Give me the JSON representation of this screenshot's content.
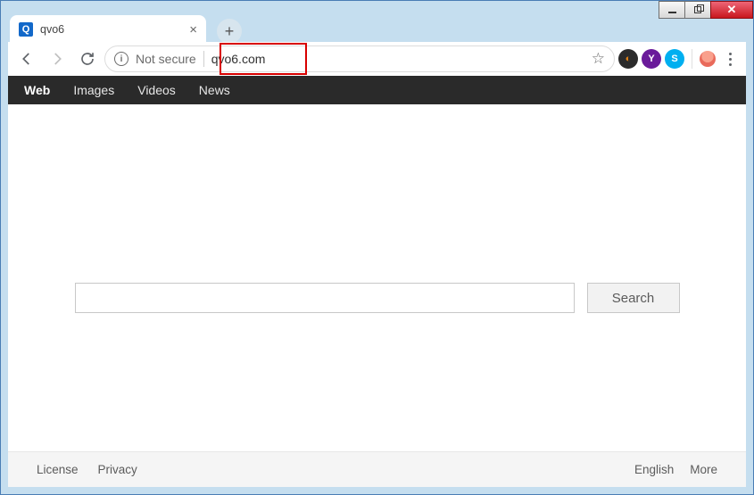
{
  "window": {
    "tab_title": "qvo6",
    "favicon_letter": "Q"
  },
  "toolbar": {
    "not_secure": "Not secure",
    "url": "qvo6.com"
  },
  "site_nav": {
    "items": [
      "Web",
      "Images",
      "Videos",
      "News"
    ],
    "active_index": 0
  },
  "search": {
    "input_value": "",
    "button_label": "Search"
  },
  "footer": {
    "left": [
      "License",
      "Privacy"
    ],
    "right": [
      "English",
      "More"
    ]
  }
}
